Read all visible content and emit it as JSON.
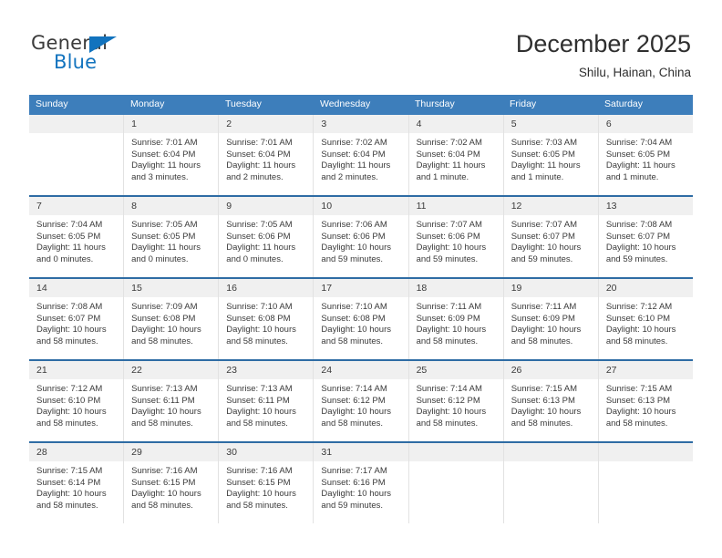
{
  "brand": {
    "name_top": "General",
    "name_bottom": "Blue",
    "triangle_color": "#1273be",
    "text_color": "#3b3b3b"
  },
  "header": {
    "title": "December 2025",
    "subtitle": "Shilu, Hainan, China"
  },
  "theme": {
    "header_blue": "#3d7ebb",
    "week_divider": "#2e6ca4",
    "number_row_bg": "#f0f0f0",
    "cell_border": "#e2e2e2",
    "text": "#3a3a3a"
  },
  "weekdays": [
    "Sunday",
    "Monday",
    "Tuesday",
    "Wednesday",
    "Thursday",
    "Friday",
    "Saturday"
  ],
  "calendar": {
    "month": "December",
    "year": 2025,
    "weeks": [
      {
        "days": [
          {
            "date": "",
            "sunrise": "",
            "sunset": "",
            "daylight_1": "",
            "daylight_2": "",
            "empty": true
          },
          {
            "date": "1",
            "sunrise": "Sunrise: 7:01 AM",
            "sunset": "Sunset: 6:04 PM",
            "daylight_1": "Daylight: 11 hours",
            "daylight_2": "and 3 minutes."
          },
          {
            "date": "2",
            "sunrise": "Sunrise: 7:01 AM",
            "sunset": "Sunset: 6:04 PM",
            "daylight_1": "Daylight: 11 hours",
            "daylight_2": "and 2 minutes."
          },
          {
            "date": "3",
            "sunrise": "Sunrise: 7:02 AM",
            "sunset": "Sunset: 6:04 PM",
            "daylight_1": "Daylight: 11 hours",
            "daylight_2": "and 2 minutes."
          },
          {
            "date": "4",
            "sunrise": "Sunrise: 7:02 AM",
            "sunset": "Sunset: 6:04 PM",
            "daylight_1": "Daylight: 11 hours",
            "daylight_2": "and 1 minute."
          },
          {
            "date": "5",
            "sunrise": "Sunrise: 7:03 AM",
            "sunset": "Sunset: 6:05 PM",
            "daylight_1": "Daylight: 11 hours",
            "daylight_2": "and 1 minute."
          },
          {
            "date": "6",
            "sunrise": "Sunrise: 7:04 AM",
            "sunset": "Sunset: 6:05 PM",
            "daylight_1": "Daylight: 11 hours",
            "daylight_2": "and 1 minute."
          }
        ]
      },
      {
        "days": [
          {
            "date": "7",
            "sunrise": "Sunrise: 7:04 AM",
            "sunset": "Sunset: 6:05 PM",
            "daylight_1": "Daylight: 11 hours",
            "daylight_2": "and 0 minutes."
          },
          {
            "date": "8",
            "sunrise": "Sunrise: 7:05 AM",
            "sunset": "Sunset: 6:05 PM",
            "daylight_1": "Daylight: 11 hours",
            "daylight_2": "and 0 minutes."
          },
          {
            "date": "9",
            "sunrise": "Sunrise: 7:05 AM",
            "sunset": "Sunset: 6:06 PM",
            "daylight_1": "Daylight: 11 hours",
            "daylight_2": "and 0 minutes."
          },
          {
            "date": "10",
            "sunrise": "Sunrise: 7:06 AM",
            "sunset": "Sunset: 6:06 PM",
            "daylight_1": "Daylight: 10 hours",
            "daylight_2": "and 59 minutes."
          },
          {
            "date": "11",
            "sunrise": "Sunrise: 7:07 AM",
            "sunset": "Sunset: 6:06 PM",
            "daylight_1": "Daylight: 10 hours",
            "daylight_2": "and 59 minutes."
          },
          {
            "date": "12",
            "sunrise": "Sunrise: 7:07 AM",
            "sunset": "Sunset: 6:07 PM",
            "daylight_1": "Daylight: 10 hours",
            "daylight_2": "and 59 minutes."
          },
          {
            "date": "13",
            "sunrise": "Sunrise: 7:08 AM",
            "sunset": "Sunset: 6:07 PM",
            "daylight_1": "Daylight: 10 hours",
            "daylight_2": "and 59 minutes."
          }
        ]
      },
      {
        "days": [
          {
            "date": "14",
            "sunrise": "Sunrise: 7:08 AM",
            "sunset": "Sunset: 6:07 PM",
            "daylight_1": "Daylight: 10 hours",
            "daylight_2": "and 58 minutes."
          },
          {
            "date": "15",
            "sunrise": "Sunrise: 7:09 AM",
            "sunset": "Sunset: 6:08 PM",
            "daylight_1": "Daylight: 10 hours",
            "daylight_2": "and 58 minutes."
          },
          {
            "date": "16",
            "sunrise": "Sunrise: 7:10 AM",
            "sunset": "Sunset: 6:08 PM",
            "daylight_1": "Daylight: 10 hours",
            "daylight_2": "and 58 minutes."
          },
          {
            "date": "17",
            "sunrise": "Sunrise: 7:10 AM",
            "sunset": "Sunset: 6:08 PM",
            "daylight_1": "Daylight: 10 hours",
            "daylight_2": "and 58 minutes."
          },
          {
            "date": "18",
            "sunrise": "Sunrise: 7:11 AM",
            "sunset": "Sunset: 6:09 PM",
            "daylight_1": "Daylight: 10 hours",
            "daylight_2": "and 58 minutes."
          },
          {
            "date": "19",
            "sunrise": "Sunrise: 7:11 AM",
            "sunset": "Sunset: 6:09 PM",
            "daylight_1": "Daylight: 10 hours",
            "daylight_2": "and 58 minutes."
          },
          {
            "date": "20",
            "sunrise": "Sunrise: 7:12 AM",
            "sunset": "Sunset: 6:10 PM",
            "daylight_1": "Daylight: 10 hours",
            "daylight_2": "and 58 minutes."
          }
        ]
      },
      {
        "days": [
          {
            "date": "21",
            "sunrise": "Sunrise: 7:12 AM",
            "sunset": "Sunset: 6:10 PM",
            "daylight_1": "Daylight: 10 hours",
            "daylight_2": "and 58 minutes."
          },
          {
            "date": "22",
            "sunrise": "Sunrise: 7:13 AM",
            "sunset": "Sunset: 6:11 PM",
            "daylight_1": "Daylight: 10 hours",
            "daylight_2": "and 58 minutes."
          },
          {
            "date": "23",
            "sunrise": "Sunrise: 7:13 AM",
            "sunset": "Sunset: 6:11 PM",
            "daylight_1": "Daylight: 10 hours",
            "daylight_2": "and 58 minutes."
          },
          {
            "date": "24",
            "sunrise": "Sunrise: 7:14 AM",
            "sunset": "Sunset: 6:12 PM",
            "daylight_1": "Daylight: 10 hours",
            "daylight_2": "and 58 minutes."
          },
          {
            "date": "25",
            "sunrise": "Sunrise: 7:14 AM",
            "sunset": "Sunset: 6:12 PM",
            "daylight_1": "Daylight: 10 hours",
            "daylight_2": "and 58 minutes."
          },
          {
            "date": "26",
            "sunrise": "Sunrise: 7:15 AM",
            "sunset": "Sunset: 6:13 PM",
            "daylight_1": "Daylight: 10 hours",
            "daylight_2": "and 58 minutes."
          },
          {
            "date": "27",
            "sunrise": "Sunrise: 7:15 AM",
            "sunset": "Sunset: 6:13 PM",
            "daylight_1": "Daylight: 10 hours",
            "daylight_2": "and 58 minutes."
          }
        ]
      },
      {
        "days": [
          {
            "date": "28",
            "sunrise": "Sunrise: 7:15 AM",
            "sunset": "Sunset: 6:14 PM",
            "daylight_1": "Daylight: 10 hours",
            "daylight_2": "and 58 minutes."
          },
          {
            "date": "29",
            "sunrise": "Sunrise: 7:16 AM",
            "sunset": "Sunset: 6:15 PM",
            "daylight_1": "Daylight: 10 hours",
            "daylight_2": "and 58 minutes."
          },
          {
            "date": "30",
            "sunrise": "Sunrise: 7:16 AM",
            "sunset": "Sunset: 6:15 PM",
            "daylight_1": "Daylight: 10 hours",
            "daylight_2": "and 58 minutes."
          },
          {
            "date": "31",
            "sunrise": "Sunrise: 7:17 AM",
            "sunset": "Sunset: 6:16 PM",
            "daylight_1": "Daylight: 10 hours",
            "daylight_2": "and 59 minutes."
          },
          {
            "date": "",
            "sunrise": "",
            "sunset": "",
            "daylight_1": "",
            "daylight_2": "",
            "empty": true
          },
          {
            "date": "",
            "sunrise": "",
            "sunset": "",
            "daylight_1": "",
            "daylight_2": "",
            "empty": true
          },
          {
            "date": "",
            "sunrise": "",
            "sunset": "",
            "daylight_1": "",
            "daylight_2": "",
            "empty": true
          }
        ]
      }
    ]
  }
}
